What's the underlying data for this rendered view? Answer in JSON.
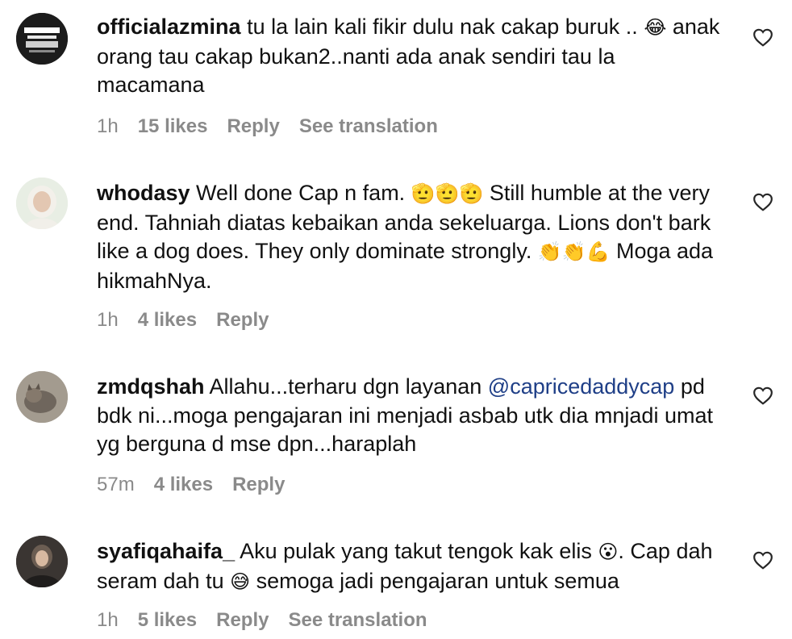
{
  "comments": [
    {
      "username": "officialazmina",
      "text_parts": [
        "tu la lain kali fikir dulu nak cakap buruk .. ",
        "😂",
        " anak orang tau cakap bukan2..nanti ada anak sendiri tau la macamana"
      ],
      "time": "1h",
      "likes": "15 likes",
      "reply": "Reply",
      "translate": "See translation",
      "avatar_text": "MY NAME IS AZMINA MALAYSIA"
    },
    {
      "username": "whodasy",
      "text_parts": [
        "Well done Cap n fam. ",
        "🫡🫡🫡",
        " Still humble at the very end. Tahniah diatas kebaikan anda sekeluarga. Lions don't bark like a dog does. They only dominate strongly. ",
        "👏👏💪",
        " Moga ada hikmahNya."
      ],
      "time": "1h",
      "likes": "4 likes",
      "reply": "Reply"
    },
    {
      "username": "zmdqshah",
      "text_before": "Allahu...terharu dgn layanan ",
      "mention": "@capricedaddycap",
      "text_after": " pd bdk ni...moga pengajaran ini menjadi asbab utk dia mnjadi umat yg berguna d mse dpn...haraplah",
      "time": "57m",
      "likes": "4 likes",
      "reply": "Reply"
    },
    {
      "username": "syafiqahaifa_",
      "text_parts": [
        "Aku pulak yang takut tengok kak elis ",
        "😮",
        ". Cap dah seram dah tu ",
        "😅",
        " semoga jadi pengajaran untuk semua"
      ],
      "time": "1h",
      "likes": "5 likes",
      "reply": "Reply",
      "translate": "See translation"
    }
  ]
}
